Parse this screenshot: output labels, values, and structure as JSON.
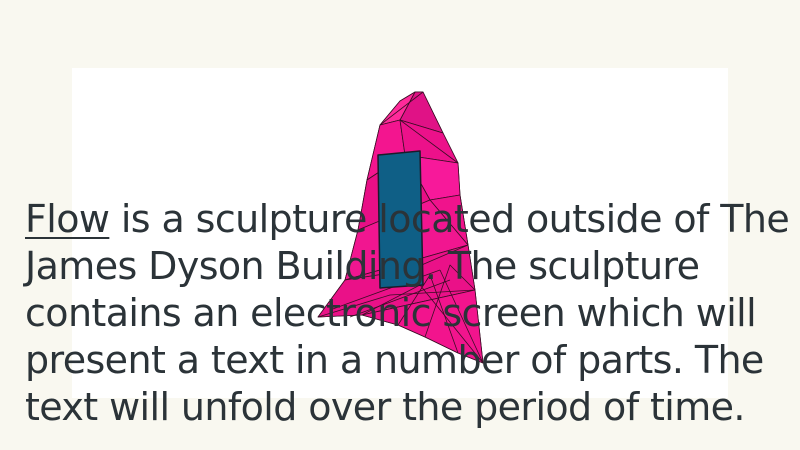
{
  "intro": {
    "link_text": "Flow",
    "body_text": " is a sculpture located outside of The James Dyson Building. The sculpture contains an electronic screen which will present a text in a number of parts. The text will unfold over the period of time."
  },
  "colors": {
    "background": "#f9f8f0",
    "card": "#ffffff",
    "sculpture_pink": "#f0138c",
    "screen_blue": "#0f5f86",
    "text": "#2b3338"
  }
}
